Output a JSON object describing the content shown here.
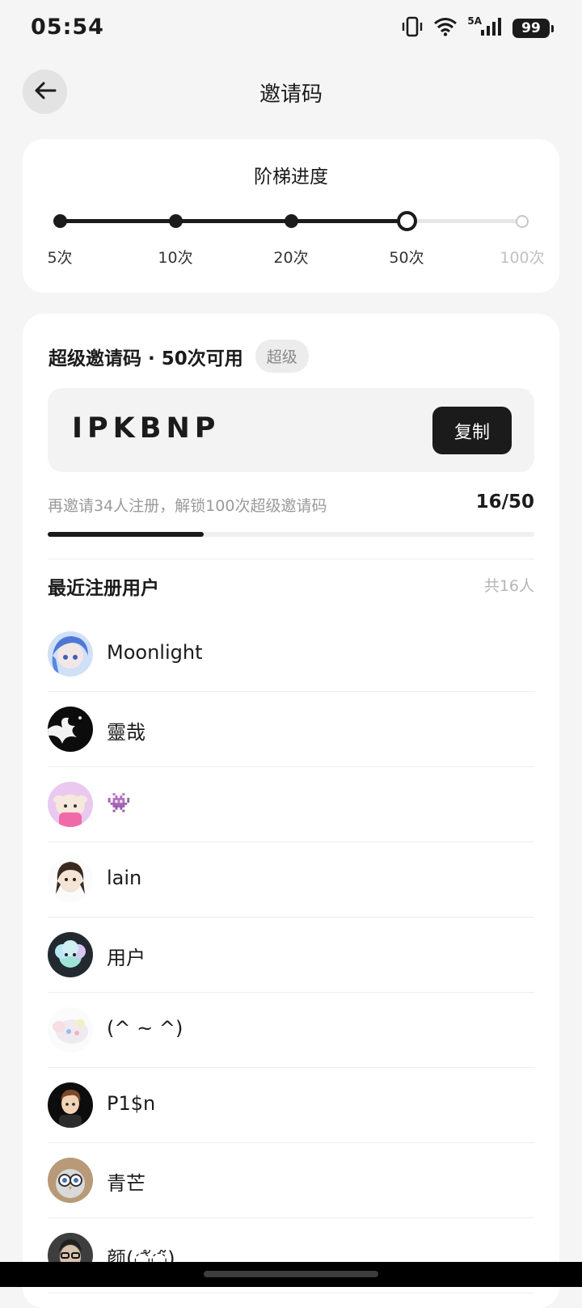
{
  "status_bar": {
    "time": "05:54",
    "network": "5A",
    "battery": "99",
    "icons": [
      "vibrate-icon",
      "wifi-icon",
      "signal-icon",
      "battery-icon"
    ]
  },
  "header": {
    "title": "邀请码",
    "back_icon": "arrow-left-icon"
  },
  "ladder": {
    "title": "阶梯进度",
    "steps": [
      {
        "label": "5次",
        "state": "done"
      },
      {
        "label": "10次",
        "state": "done"
      },
      {
        "label": "20次",
        "state": "done"
      },
      {
        "label": "50次",
        "state": "current"
      },
      {
        "label": "100次",
        "state": "future"
      }
    ]
  },
  "invite_code": {
    "heading": "超级邀请码 · 50次可用",
    "badge": "超级",
    "code": "IPKBNP",
    "copy_label": "复制",
    "progress_hint": "再邀请34人注册，解锁100次超级邀请码",
    "progress_count": "16/50",
    "progress_fraction": 0.32
  },
  "recent_users": {
    "title": "最近注册用户",
    "count": "共16人",
    "users": [
      {
        "name": "Moonlight",
        "avatar": "anime-blue-avatar"
      },
      {
        "name": "靈哉",
        "avatar": "dark-splash-avatar"
      },
      {
        "name": "👾",
        "avatar": "pink-bunny-avatar"
      },
      {
        "name": "lain",
        "avatar": "sketch-girl-avatar"
      },
      {
        "name": "用户",
        "avatar": "cloud-mascot-avatar"
      },
      {
        "name": "(^ ~ ^)",
        "avatar": "pastel-plush-avatar"
      },
      {
        "name": "P1$n",
        "avatar": "cartoon-boy-avatar"
      },
      {
        "name": "青芒",
        "avatar": "owl-avatar"
      },
      {
        "name": "颜(◌ั◌̃)",
        "avatar": "glasses-person-avatar"
      }
    ]
  },
  "colors": {
    "accent": "#1b1b1b",
    "background": "#f5f5f5",
    "card": "#ffffff",
    "muted_text": "#9a9a9a",
    "inactive": "#c8c8c8"
  }
}
